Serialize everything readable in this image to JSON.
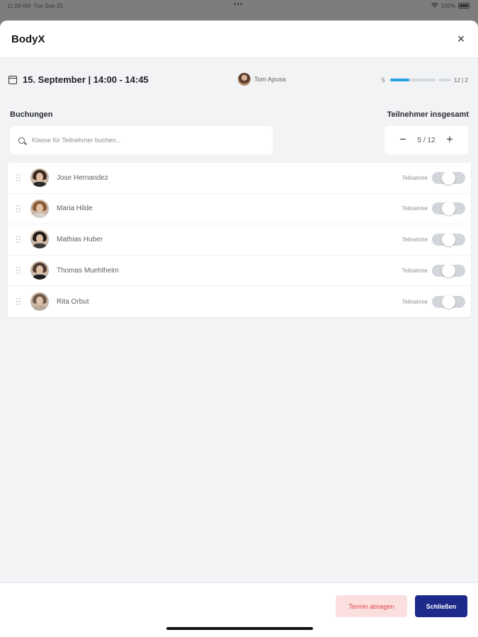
{
  "status_bar": {
    "time": "11:09 AM",
    "date": "Tue Sep 20",
    "dots": "•••",
    "battery": "100%"
  },
  "modal": {
    "title": "BodyX",
    "close_label": "×"
  },
  "session": {
    "date_time": "15. September | 14:00 - 14:45",
    "trainer_name": "Tom Apusa",
    "capacity_min": "5",
    "capacity_max_label": "12 | 2",
    "capacity_fill_fraction": 0.42
  },
  "bookings": {
    "section_label": "Buchungen",
    "search_placeholder": "Klasse für Teilnehmer buchen..."
  },
  "participants_total": {
    "section_label": "Teilnehmer insgesamt",
    "minus_label": "−",
    "plus_label": "+",
    "value": "5 / 12"
  },
  "attendees": [
    {
      "name": "Jose Hernandez",
      "toggle_label": "Teilnahme",
      "hair": "#3b2a22",
      "shirt": "#2c2c2c"
    },
    {
      "name": "Maria Hilde",
      "toggle_label": "Teilnahme",
      "hair": "#8a5a36",
      "shirt": "#d9d0c5"
    },
    {
      "name": "Mathias Huber",
      "toggle_label": "Teilnahme",
      "hair": "#221a16",
      "shirt": "#3b3b3b"
    },
    {
      "name": "Thomas Muehlheim",
      "toggle_label": "Teilnahme",
      "hair": "#4a3a30",
      "shirt": "#1f1f1f"
    },
    {
      "name": "Rita Orbut",
      "toggle_label": "Teilnahme",
      "hair": "#6b5a4c",
      "shirt": "#b9a99a"
    }
  ],
  "footer": {
    "cancel_label": "Termin absagen",
    "close_label": "Schließen"
  },
  "colors": {
    "accent": "#21a3e0",
    "primary": "#1d2a8a",
    "danger": "#e04848",
    "danger_bg": "#fbdede"
  }
}
